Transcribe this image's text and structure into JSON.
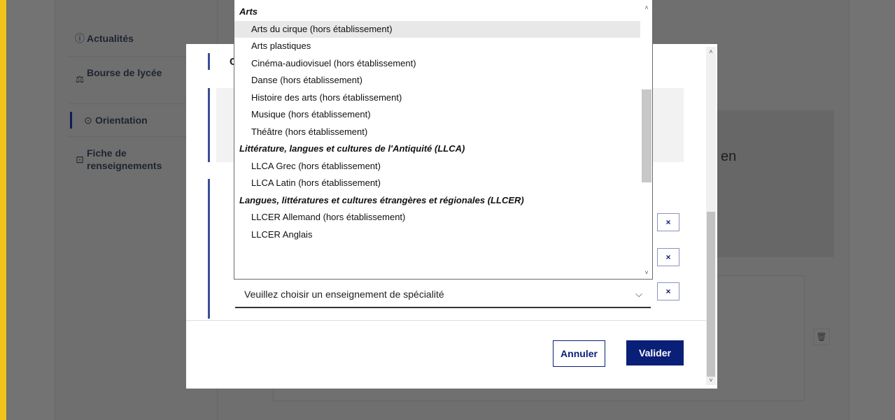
{
  "sidebar": {
    "items": [
      {
        "icon": "info-icon",
        "glyph": "ⓘ",
        "label": "Actualités"
      },
      {
        "icon": "scholarship-icon",
        "glyph": "⚖",
        "label": "Bourse de lycée"
      },
      {
        "icon": "compass-icon",
        "glyph": "⊙",
        "label": "Orientation"
      },
      {
        "icon": "form-icon",
        "glyph": "⊡",
        "label": "Fiche de renseignements"
      }
    ]
  },
  "background": {
    "partial_text": "is en"
  },
  "modal": {
    "title_partial": "C",
    "remove_label": "×",
    "cancel_label": "Annuler",
    "confirm_label": "Valider"
  },
  "select": {
    "placeholder": "Veuillez choisir un enseignement de spécialité"
  },
  "dropdown": {
    "options": [
      {
        "label": "Arts",
        "group": true
      },
      {
        "label": "Arts du cirque (hors établissement)",
        "group": false,
        "highlighted": true
      },
      {
        "label": "Arts plastiques",
        "group": false
      },
      {
        "label": "Cinéma-audiovisuel (hors établissement)",
        "group": false
      },
      {
        "label": "Danse (hors établissement)",
        "group": false
      },
      {
        "label": "Histoire des arts (hors établissement)",
        "group": false
      },
      {
        "label": "Musique (hors établissement)",
        "group": false
      },
      {
        "label": "Théâtre (hors établissement)",
        "group": false
      },
      {
        "label": "Littérature, langues et cultures de l'Antiquité (LLCA)",
        "group": true
      },
      {
        "label": "LLCA Grec (hors établissement)",
        "group": false
      },
      {
        "label": "LLCA Latin (hors établissement)",
        "group": false
      },
      {
        "label": "Langues, littératures et cultures étrangères et régionales (LLCER)",
        "group": true
      },
      {
        "label": "LLCER Allemand (hors établissement)",
        "group": false
      },
      {
        "label": "LLCER Anglais",
        "group": false
      }
    ]
  },
  "colors": {
    "accent": "#0a1f77",
    "highlight_bar": "#f0c419"
  }
}
